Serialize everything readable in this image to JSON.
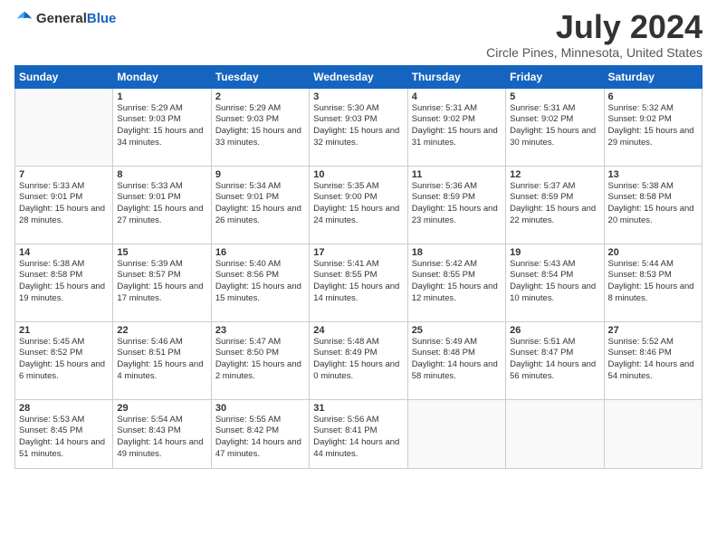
{
  "header": {
    "logo_line1": "General",
    "logo_line2": "Blue",
    "month_year": "July 2024",
    "location": "Circle Pines, Minnesota, United States"
  },
  "weekdays": [
    "Sunday",
    "Monday",
    "Tuesday",
    "Wednesday",
    "Thursday",
    "Friday",
    "Saturday"
  ],
  "weeks": [
    [
      {
        "day": "",
        "sunrise": "",
        "sunset": "",
        "daylight": ""
      },
      {
        "day": "1",
        "sunrise": "Sunrise: 5:29 AM",
        "sunset": "Sunset: 9:03 PM",
        "daylight": "Daylight: 15 hours and 34 minutes."
      },
      {
        "day": "2",
        "sunrise": "Sunrise: 5:29 AM",
        "sunset": "Sunset: 9:03 PM",
        "daylight": "Daylight: 15 hours and 33 minutes."
      },
      {
        "day": "3",
        "sunrise": "Sunrise: 5:30 AM",
        "sunset": "Sunset: 9:03 PM",
        "daylight": "Daylight: 15 hours and 32 minutes."
      },
      {
        "day": "4",
        "sunrise": "Sunrise: 5:31 AM",
        "sunset": "Sunset: 9:02 PM",
        "daylight": "Daylight: 15 hours and 31 minutes."
      },
      {
        "day": "5",
        "sunrise": "Sunrise: 5:31 AM",
        "sunset": "Sunset: 9:02 PM",
        "daylight": "Daylight: 15 hours and 30 minutes."
      },
      {
        "day": "6",
        "sunrise": "Sunrise: 5:32 AM",
        "sunset": "Sunset: 9:02 PM",
        "daylight": "Daylight: 15 hours and 29 minutes."
      }
    ],
    [
      {
        "day": "7",
        "sunrise": "Sunrise: 5:33 AM",
        "sunset": "Sunset: 9:01 PM",
        "daylight": "Daylight: 15 hours and 28 minutes."
      },
      {
        "day": "8",
        "sunrise": "Sunrise: 5:33 AM",
        "sunset": "Sunset: 9:01 PM",
        "daylight": "Daylight: 15 hours and 27 minutes."
      },
      {
        "day": "9",
        "sunrise": "Sunrise: 5:34 AM",
        "sunset": "Sunset: 9:01 PM",
        "daylight": "Daylight: 15 hours and 26 minutes."
      },
      {
        "day": "10",
        "sunrise": "Sunrise: 5:35 AM",
        "sunset": "Sunset: 9:00 PM",
        "daylight": "Daylight: 15 hours and 24 minutes."
      },
      {
        "day": "11",
        "sunrise": "Sunrise: 5:36 AM",
        "sunset": "Sunset: 8:59 PM",
        "daylight": "Daylight: 15 hours and 23 minutes."
      },
      {
        "day": "12",
        "sunrise": "Sunrise: 5:37 AM",
        "sunset": "Sunset: 8:59 PM",
        "daylight": "Daylight: 15 hours and 22 minutes."
      },
      {
        "day": "13",
        "sunrise": "Sunrise: 5:38 AM",
        "sunset": "Sunset: 8:58 PM",
        "daylight": "Daylight: 15 hours and 20 minutes."
      }
    ],
    [
      {
        "day": "14",
        "sunrise": "Sunrise: 5:38 AM",
        "sunset": "Sunset: 8:58 PM",
        "daylight": "Daylight: 15 hours and 19 minutes."
      },
      {
        "day": "15",
        "sunrise": "Sunrise: 5:39 AM",
        "sunset": "Sunset: 8:57 PM",
        "daylight": "Daylight: 15 hours and 17 minutes."
      },
      {
        "day": "16",
        "sunrise": "Sunrise: 5:40 AM",
        "sunset": "Sunset: 8:56 PM",
        "daylight": "Daylight: 15 hours and 15 minutes."
      },
      {
        "day": "17",
        "sunrise": "Sunrise: 5:41 AM",
        "sunset": "Sunset: 8:55 PM",
        "daylight": "Daylight: 15 hours and 14 minutes."
      },
      {
        "day": "18",
        "sunrise": "Sunrise: 5:42 AM",
        "sunset": "Sunset: 8:55 PM",
        "daylight": "Daylight: 15 hours and 12 minutes."
      },
      {
        "day": "19",
        "sunrise": "Sunrise: 5:43 AM",
        "sunset": "Sunset: 8:54 PM",
        "daylight": "Daylight: 15 hours and 10 minutes."
      },
      {
        "day": "20",
        "sunrise": "Sunrise: 5:44 AM",
        "sunset": "Sunset: 8:53 PM",
        "daylight": "Daylight: 15 hours and 8 minutes."
      }
    ],
    [
      {
        "day": "21",
        "sunrise": "Sunrise: 5:45 AM",
        "sunset": "Sunset: 8:52 PM",
        "daylight": "Daylight: 15 hours and 6 minutes."
      },
      {
        "day": "22",
        "sunrise": "Sunrise: 5:46 AM",
        "sunset": "Sunset: 8:51 PM",
        "daylight": "Daylight: 15 hours and 4 minutes."
      },
      {
        "day": "23",
        "sunrise": "Sunrise: 5:47 AM",
        "sunset": "Sunset: 8:50 PM",
        "daylight": "Daylight: 15 hours and 2 minutes."
      },
      {
        "day": "24",
        "sunrise": "Sunrise: 5:48 AM",
        "sunset": "Sunset: 8:49 PM",
        "daylight": "Daylight: 15 hours and 0 minutes."
      },
      {
        "day": "25",
        "sunrise": "Sunrise: 5:49 AM",
        "sunset": "Sunset: 8:48 PM",
        "daylight": "Daylight: 14 hours and 58 minutes."
      },
      {
        "day": "26",
        "sunrise": "Sunrise: 5:51 AM",
        "sunset": "Sunset: 8:47 PM",
        "daylight": "Daylight: 14 hours and 56 minutes."
      },
      {
        "day": "27",
        "sunrise": "Sunrise: 5:52 AM",
        "sunset": "Sunset: 8:46 PM",
        "daylight": "Daylight: 14 hours and 54 minutes."
      }
    ],
    [
      {
        "day": "28",
        "sunrise": "Sunrise: 5:53 AM",
        "sunset": "Sunset: 8:45 PM",
        "daylight": "Daylight: 14 hours and 51 minutes."
      },
      {
        "day": "29",
        "sunrise": "Sunrise: 5:54 AM",
        "sunset": "Sunset: 8:43 PM",
        "daylight": "Daylight: 14 hours and 49 minutes."
      },
      {
        "day": "30",
        "sunrise": "Sunrise: 5:55 AM",
        "sunset": "Sunset: 8:42 PM",
        "daylight": "Daylight: 14 hours and 47 minutes."
      },
      {
        "day": "31",
        "sunrise": "Sunrise: 5:56 AM",
        "sunset": "Sunset: 8:41 PM",
        "daylight": "Daylight: 14 hours and 44 minutes."
      },
      {
        "day": "",
        "sunrise": "",
        "sunset": "",
        "daylight": ""
      },
      {
        "day": "",
        "sunrise": "",
        "sunset": "",
        "daylight": ""
      },
      {
        "day": "",
        "sunrise": "",
        "sunset": "",
        "daylight": ""
      }
    ]
  ]
}
